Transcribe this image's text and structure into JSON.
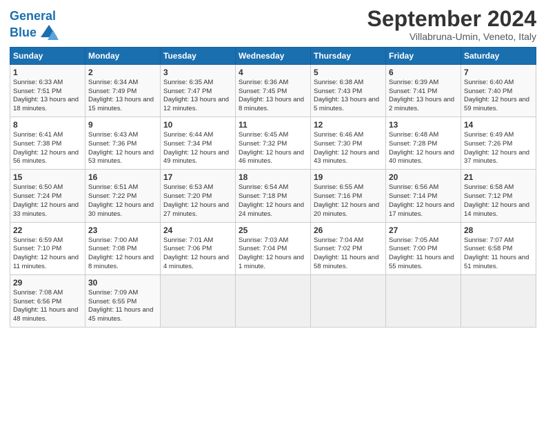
{
  "header": {
    "logo_line1": "General",
    "logo_line2": "Blue",
    "month": "September 2024",
    "location": "Villabruna-Umin, Veneto, Italy"
  },
  "days_of_week": [
    "Sunday",
    "Monday",
    "Tuesday",
    "Wednesday",
    "Thursday",
    "Friday",
    "Saturday"
  ],
  "weeks": [
    [
      {
        "day": "1",
        "sunrise": "6:33 AM",
        "sunset": "7:51 PM",
        "daylight": "13 hours and 18 minutes."
      },
      {
        "day": "2",
        "sunrise": "6:34 AM",
        "sunset": "7:49 PM",
        "daylight": "13 hours and 15 minutes."
      },
      {
        "day": "3",
        "sunrise": "6:35 AM",
        "sunset": "7:47 PM",
        "daylight": "13 hours and 12 minutes."
      },
      {
        "day": "4",
        "sunrise": "6:36 AM",
        "sunset": "7:45 PM",
        "daylight": "13 hours and 8 minutes."
      },
      {
        "day": "5",
        "sunrise": "6:38 AM",
        "sunset": "7:43 PM",
        "daylight": "13 hours and 5 minutes."
      },
      {
        "day": "6",
        "sunrise": "6:39 AM",
        "sunset": "7:41 PM",
        "daylight": "13 hours and 2 minutes."
      },
      {
        "day": "7",
        "sunrise": "6:40 AM",
        "sunset": "7:40 PM",
        "daylight": "12 hours and 59 minutes."
      }
    ],
    [
      {
        "day": "8",
        "sunrise": "6:41 AM",
        "sunset": "7:38 PM",
        "daylight": "12 hours and 56 minutes."
      },
      {
        "day": "9",
        "sunrise": "6:43 AM",
        "sunset": "7:36 PM",
        "daylight": "12 hours and 53 minutes."
      },
      {
        "day": "10",
        "sunrise": "6:44 AM",
        "sunset": "7:34 PM",
        "daylight": "12 hours and 49 minutes."
      },
      {
        "day": "11",
        "sunrise": "6:45 AM",
        "sunset": "7:32 PM",
        "daylight": "12 hours and 46 minutes."
      },
      {
        "day": "12",
        "sunrise": "6:46 AM",
        "sunset": "7:30 PM",
        "daylight": "12 hours and 43 minutes."
      },
      {
        "day": "13",
        "sunrise": "6:48 AM",
        "sunset": "7:28 PM",
        "daylight": "12 hours and 40 minutes."
      },
      {
        "day": "14",
        "sunrise": "6:49 AM",
        "sunset": "7:26 PM",
        "daylight": "12 hours and 37 minutes."
      }
    ],
    [
      {
        "day": "15",
        "sunrise": "6:50 AM",
        "sunset": "7:24 PM",
        "daylight": "12 hours and 33 minutes."
      },
      {
        "day": "16",
        "sunrise": "6:51 AM",
        "sunset": "7:22 PM",
        "daylight": "12 hours and 30 minutes."
      },
      {
        "day": "17",
        "sunrise": "6:53 AM",
        "sunset": "7:20 PM",
        "daylight": "12 hours and 27 minutes."
      },
      {
        "day": "18",
        "sunrise": "6:54 AM",
        "sunset": "7:18 PM",
        "daylight": "12 hours and 24 minutes."
      },
      {
        "day": "19",
        "sunrise": "6:55 AM",
        "sunset": "7:16 PM",
        "daylight": "12 hours and 20 minutes."
      },
      {
        "day": "20",
        "sunrise": "6:56 AM",
        "sunset": "7:14 PM",
        "daylight": "12 hours and 17 minutes."
      },
      {
        "day": "21",
        "sunrise": "6:58 AM",
        "sunset": "7:12 PM",
        "daylight": "12 hours and 14 minutes."
      }
    ],
    [
      {
        "day": "22",
        "sunrise": "6:59 AM",
        "sunset": "7:10 PM",
        "daylight": "12 hours and 11 minutes."
      },
      {
        "day": "23",
        "sunrise": "7:00 AM",
        "sunset": "7:08 PM",
        "daylight": "12 hours and 8 minutes."
      },
      {
        "day": "24",
        "sunrise": "7:01 AM",
        "sunset": "7:06 PM",
        "daylight": "12 hours and 4 minutes."
      },
      {
        "day": "25",
        "sunrise": "7:03 AM",
        "sunset": "7:04 PM",
        "daylight": "12 hours and 1 minute."
      },
      {
        "day": "26",
        "sunrise": "7:04 AM",
        "sunset": "7:02 PM",
        "daylight": "11 hours and 58 minutes."
      },
      {
        "day": "27",
        "sunrise": "7:05 AM",
        "sunset": "7:00 PM",
        "daylight": "11 hours and 55 minutes."
      },
      {
        "day": "28",
        "sunrise": "7:07 AM",
        "sunset": "6:58 PM",
        "daylight": "11 hours and 51 minutes."
      }
    ],
    [
      {
        "day": "29",
        "sunrise": "7:08 AM",
        "sunset": "6:56 PM",
        "daylight": "11 hours and 48 minutes."
      },
      {
        "day": "30",
        "sunrise": "7:09 AM",
        "sunset": "6:55 PM",
        "daylight": "11 hours and 45 minutes."
      },
      null,
      null,
      null,
      null,
      null
    ]
  ]
}
